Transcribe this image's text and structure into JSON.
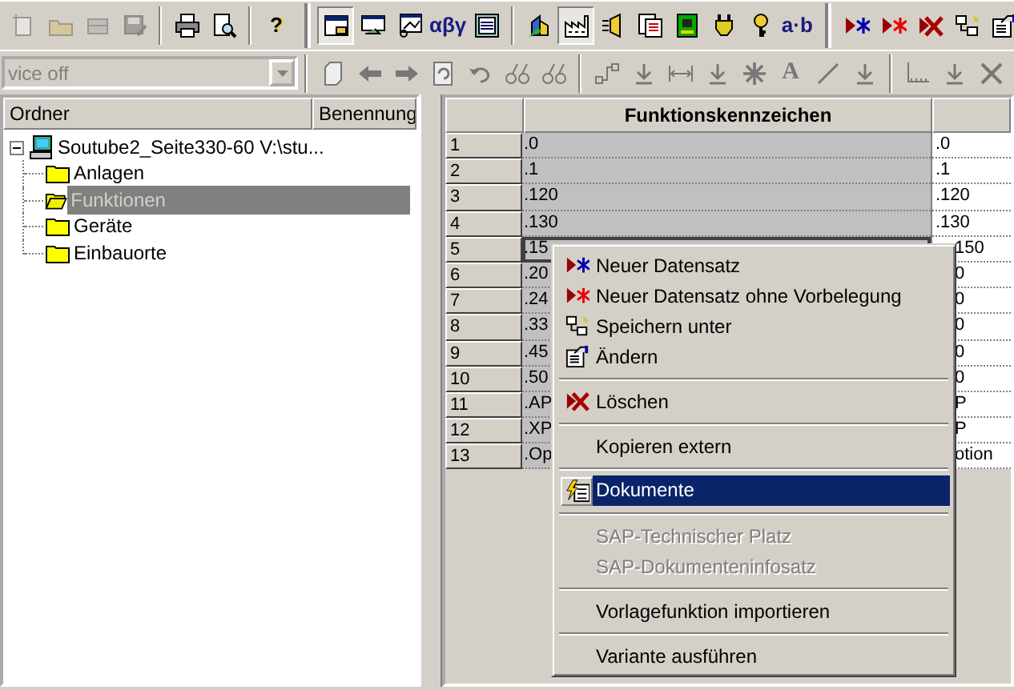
{
  "toolbars": [
    [
      {
        "kind": "new",
        "disabled": true
      },
      {
        "kind": "open",
        "disabled": true
      },
      {
        "kind": "box",
        "disabled": true
      },
      {
        "kind": "save",
        "disabled": true
      },
      {
        "kind": "separator"
      },
      {
        "kind": "print",
        "disabled": false
      },
      {
        "kind": "preview",
        "disabled": false
      },
      {
        "kind": "separator"
      },
      {
        "kind": "glyph",
        "text": "?",
        "disabled": false
      },
      {
        "kind": "grip"
      },
      {
        "kind": "window",
        "pressed": true,
        "disabled": false
      },
      {
        "kind": "form",
        "disabled": false
      },
      {
        "kind": "chart",
        "disabled": false
      },
      {
        "kind": "glyph",
        "text": "αβγ",
        "disabled": false
      },
      {
        "kind": "list",
        "disabled": false
      },
      {
        "kind": "separator"
      },
      {
        "kind": "blocks",
        "disabled": false
      },
      {
        "kind": "factory",
        "pressed": true,
        "disabled": false
      },
      {
        "kind": "lamp",
        "disabled": false
      },
      {
        "kind": "docs",
        "disabled": false
      },
      {
        "kind": "chip",
        "disabled": false
      },
      {
        "kind": "plug",
        "disabled": false
      },
      {
        "kind": "key",
        "disabled": false
      },
      {
        "kind": "glyph",
        "text": "a·b",
        "disabled": false
      },
      {
        "kind": "grip"
      },
      {
        "kind": "star-blue",
        "disabled": false
      },
      {
        "kind": "star-red",
        "disabled": false
      },
      {
        "kind": "delete",
        "disabled": false
      },
      {
        "kind": "tree",
        "disabled": false
      },
      {
        "kind": "edit",
        "disabled": false
      }
    ],
    [
      {
        "kind": "combo",
        "value": "vice off"
      },
      {
        "kind": "separator"
      },
      {
        "kind": "page"
      },
      {
        "kind": "left"
      },
      {
        "kind": "right"
      },
      {
        "kind": "refresh"
      },
      {
        "kind": "undo"
      },
      {
        "kind": "glasses"
      },
      {
        "kind": "glasses"
      },
      {
        "kind": "separator"
      },
      {
        "kind": "connector"
      },
      {
        "kind": "down"
      },
      {
        "kind": "dimension"
      },
      {
        "kind": "down"
      },
      {
        "kind": "asterisk"
      },
      {
        "kind": "glyph",
        "text": "A"
      },
      {
        "kind": "line"
      },
      {
        "kind": "down"
      },
      {
        "kind": "separator"
      },
      {
        "kind": "ruler"
      },
      {
        "kind": "down"
      },
      {
        "kind": "cross"
      }
    ]
  ],
  "tree": {
    "columns": [
      "Ordner",
      "Benennung"
    ],
    "root": {
      "label": "Soutube2_Seite330-60 V:\\stu...",
      "kind": "computer",
      "expanded": true,
      "selected": false,
      "children": [
        {
          "label": "Anlagen",
          "kind": "folder",
          "selected": false
        },
        {
          "label": "Funktionen",
          "kind": "folder",
          "selected": true
        },
        {
          "label": "Geräte",
          "kind": "folder",
          "selected": false
        },
        {
          "label": "Einbauorte",
          "kind": "folder",
          "selected": false
        }
      ]
    }
  },
  "grid": {
    "columns": [
      "Funktionskennzeichen"
    ],
    "rows": [
      {
        "number": "1",
        "value": ".0",
        "column_2": ".0",
        "focused": false,
        "hidden_by_menu": false
      },
      {
        "number": "2",
        "value": ".1",
        "column_2": ".1",
        "focused": false,
        "hidden_by_menu": false
      },
      {
        "number": "3",
        "value": ".120",
        "column_2": ".120",
        "focused": false,
        "hidden_by_menu": false
      },
      {
        "number": "4",
        "value": ".130",
        "column_2": ".130",
        "focused": false,
        "hidden_by_menu": false
      },
      {
        "number": "5",
        "value": ".15",
        "column_2": "150",
        "focused": true,
        "hidden_by_menu": true
      },
      {
        "number": "6",
        "value": ".20",
        "column_2": "0",
        "focused": false,
        "hidden_by_menu": true
      },
      {
        "number": "7",
        "value": ".24",
        "column_2": "0",
        "focused": false,
        "hidden_by_menu": true
      },
      {
        "number": "8",
        "value": ".33",
        "column_2": "0",
        "focused": false,
        "hidden_by_menu": true
      },
      {
        "number": "9",
        "value": ".45",
        "column_2": "0",
        "focused": false,
        "hidden_by_menu": true
      },
      {
        "number": "10",
        "value": ".50",
        "column_2": "0",
        "focused": false,
        "hidden_by_menu": true
      },
      {
        "number": "11",
        "value": ".AP",
        "column_2": "P",
        "focused": false,
        "hidden_by_menu": true
      },
      {
        "number": "12",
        "value": ".XP",
        "column_2": "P",
        "focused": false,
        "hidden_by_menu": true
      },
      {
        "number": "13",
        "value": ".Op",
        "column_2": "otion",
        "focused": false,
        "hidden_by_menu": true
      }
    ]
  },
  "context_menu": [
    {
      "kind": "new",
      "label": "Neuer Datensatz",
      "disabled": false,
      "selected": false
    },
    {
      "kind": "new-blank",
      "label": "Neuer Datensatz ohne Vorbelegung",
      "disabled": false,
      "selected": false
    },
    {
      "kind": "save-as",
      "label": "Speichern unter",
      "disabled": false,
      "selected": false
    },
    {
      "kind": "edit",
      "label": "Ändern",
      "disabled": false,
      "selected": false
    },
    {
      "kind": "separator"
    },
    {
      "kind": "delete",
      "label": "Löschen",
      "disabled": false,
      "selected": false
    },
    {
      "kind": "separator"
    },
    {
      "kind": "item",
      "label": "Kopieren extern",
      "disabled": false,
      "selected": false
    },
    {
      "kind": "separator"
    },
    {
      "kind": "documents",
      "label": "Dokumente",
      "disabled": false,
      "selected": true
    },
    {
      "kind": "separator"
    },
    {
      "kind": "item",
      "label": "SAP-Technischer Platz",
      "disabled": true,
      "selected": false
    },
    {
      "kind": "item",
      "label": "SAP-Dokumenteninfosatz",
      "disabled": true,
      "selected": false
    },
    {
      "kind": "separator"
    },
    {
      "kind": "item",
      "label": "Vorlagefunktion importieren",
      "disabled": false,
      "selected": false
    },
    {
      "kind": "separator"
    },
    {
      "kind": "item",
      "label": "Variante ausführen",
      "disabled": false,
      "selected": false
    }
  ]
}
